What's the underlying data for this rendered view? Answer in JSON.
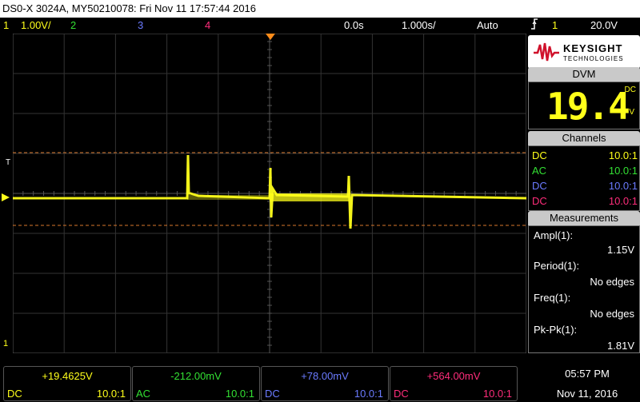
{
  "title": "DS0-X 3024A, MY50210078: Fri Nov 11 17:57:44 2016",
  "status": {
    "ch1_num": "1",
    "ch1_scale": "1.00V/",
    "ch2_num": "2",
    "ch3_num": "3",
    "ch4_num": "4",
    "time_offset": "0.0s",
    "time_scale": "1.000s/",
    "trigger_mode": "Auto",
    "trigger_icon": "trigger-edge-icon",
    "trigger_source": "1",
    "trigger_level": "20.0V"
  },
  "markers": {
    "trigger": "T",
    "ground": "1"
  },
  "logo": {
    "line1": "KEYSIGHT",
    "line2": "TECHNOLOGIES"
  },
  "dvm": {
    "title": "DVM",
    "value": "19.4",
    "coupling": "DC",
    "unit": "V"
  },
  "channels": {
    "title": "Channels",
    "rows": [
      {
        "coupling": "DC",
        "probe": "10.0:1",
        "color": "#ffff1a"
      },
      {
        "coupling": "AC",
        "probe": "10.0:1",
        "color": "#33e033"
      },
      {
        "coupling": "DC",
        "probe": "10.0:1",
        "color": "#6b7bff"
      },
      {
        "coupling": "DC",
        "probe": "10.0:1",
        "color": "#ff2d7b"
      }
    ]
  },
  "measurements": {
    "title": "Measurements",
    "items": [
      {
        "label": "Ampl(1):",
        "value": "1.15V"
      },
      {
        "label": "Period(1):",
        "value": "No edges"
      },
      {
        "label": "Freq(1):",
        "value": "No edges"
      },
      {
        "label": "Pk-Pk(1):",
        "value": "1.81V"
      }
    ]
  },
  "bottom_channels": [
    {
      "value": "+19.4625V",
      "coupling": "DC",
      "probe": "10.0:1",
      "color": "#ffff1a"
    },
    {
      "value": "-212.00mV",
      "coupling": "AC",
      "probe": "10.0:1",
      "color": "#33e033"
    },
    {
      "value": "+78.00mV",
      "coupling": "DC",
      "probe": "10.0:1",
      "color": "#6b7bff"
    },
    {
      "value": "+564.00mV",
      "coupling": "DC",
      "probe": "10.0:1",
      "color": "#ff2d7b"
    }
  ],
  "clock": {
    "time": "05:57 PM",
    "date": "Nov 11, 2016"
  },
  "colors": {
    "ch1": "#ffff1a",
    "ch2": "#33e033",
    "ch3": "#6b7bff",
    "ch4": "#ff2d7b",
    "cursor": "#d9782d",
    "trigger": "#ff8c1a"
  }
}
